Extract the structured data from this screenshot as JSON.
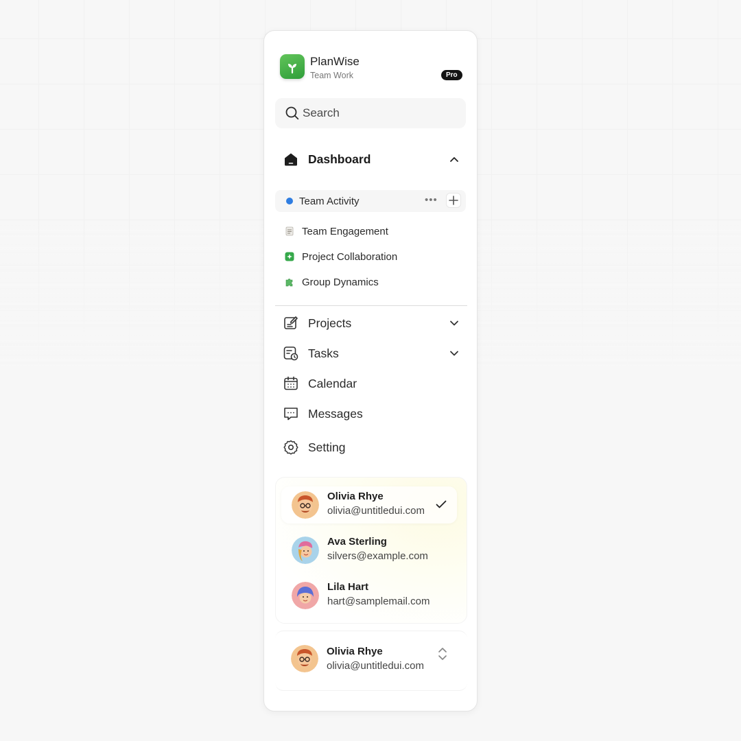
{
  "brand": {
    "name": "PlanWise",
    "subtitle": "Team Work",
    "badge": "Pro",
    "logo_icon": "sprout-icon",
    "logo_color": "#3fae47"
  },
  "search": {
    "placeholder": "Search",
    "icon": "search-icon"
  },
  "nav": {
    "dashboard": {
      "label": "Dashboard",
      "icon": "home-icon",
      "expanded": true
    },
    "sub_items": [
      {
        "label": "Team Activity",
        "icon": "blue-dot",
        "active": true,
        "color": "#2f7de1"
      },
      {
        "label": "Team Engagement",
        "icon": "document-icon"
      },
      {
        "label": "Project Collaboration",
        "icon": "sparkle-square-icon",
        "color": "#35a84a"
      },
      {
        "label": "Group Dynamics",
        "icon": "puzzle-icon"
      }
    ],
    "items": [
      {
        "label": "Projects",
        "icon": "edit-board-icon",
        "has_chevron": true
      },
      {
        "label": "Tasks",
        "icon": "task-clock-icon",
        "has_chevron": true
      },
      {
        "label": "Calendar",
        "icon": "calendar-icon",
        "has_chevron": false
      },
      {
        "label": "Messages",
        "icon": "message-icon",
        "has_chevron": false
      },
      {
        "label": "Setting",
        "icon": "gear-icon",
        "has_chevron": false
      }
    ]
  },
  "accounts": [
    {
      "name": "Olivia Rhye",
      "email": "olivia@untitledui.com",
      "selected": true
    },
    {
      "name": "Ava Sterling",
      "email": "silvers@example.com",
      "selected": false
    },
    {
      "name": "Lila Hart",
      "email": "hart@samplemail.com",
      "selected": false
    }
  ],
  "current_user": {
    "name": "Olivia Rhye",
    "email": "olivia@untitledui.com"
  }
}
